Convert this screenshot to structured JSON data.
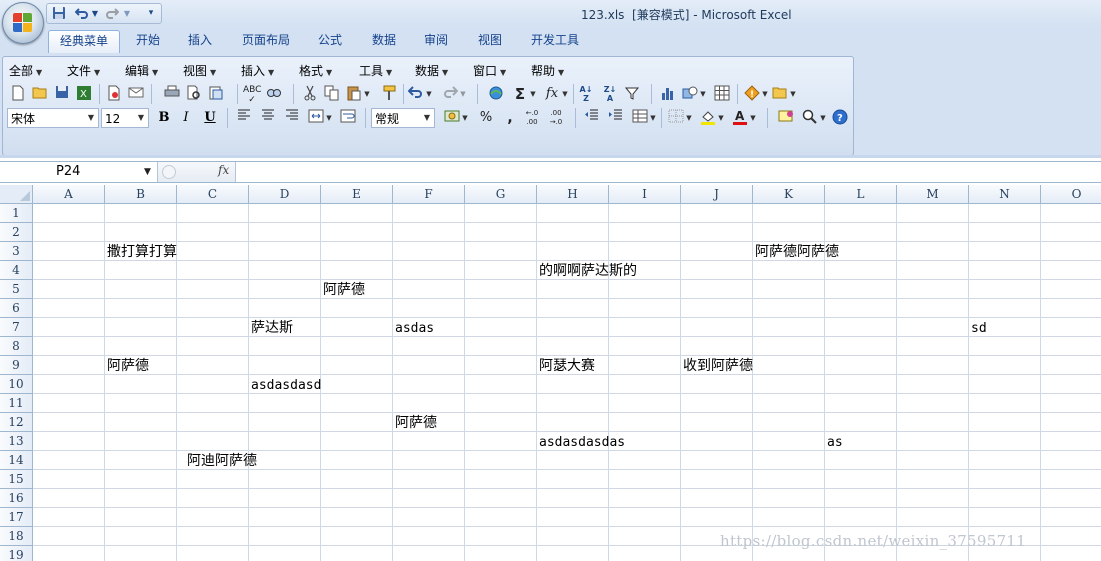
{
  "window": {
    "title": "123.xls  [兼容模式] - Microsoft Excel"
  },
  "quick_access": {
    "save_icon": "save-icon",
    "undo_icon": "undo-icon",
    "redo_icon": "redo-icon",
    "customize_icon": "customize-icon"
  },
  "ribbon_tabs": [
    "经典菜单",
    "开始",
    "插入",
    "页面布局",
    "公式",
    "数据",
    "审阅",
    "视图",
    "开发工具"
  ],
  "active_tab": "经典菜单",
  "classic_menu": [
    "全部",
    "文件",
    "编辑",
    "视图",
    "插入",
    "格式",
    "工具",
    "数据",
    "窗口",
    "帮助"
  ],
  "font": {
    "name": "宋体",
    "size": "12",
    "number_format": "常规",
    "bold_label": "B",
    "italic_label": "I",
    "underline_label": "U",
    "percent_label": "%",
    "comma_label": ","
  },
  "formula_bar": {
    "name_box": "P24",
    "fx": "fx",
    "formula": ""
  },
  "columns": [
    "A",
    "B",
    "C",
    "D",
    "E",
    "F",
    "G",
    "H",
    "I",
    "J",
    "K",
    "L",
    "M",
    "N",
    "O"
  ],
  "rows": [
    "1",
    "2",
    "3",
    "4",
    "5",
    "6",
    "7",
    "8",
    "9",
    "10",
    "11",
    "12",
    "13",
    "14",
    "15",
    "16",
    "17",
    "18",
    "19"
  ],
  "cells": [
    {
      "ref": "B3",
      "text": "撒打算打算"
    },
    {
      "ref": "K3",
      "text": "阿萨德阿萨德"
    },
    {
      "ref": "H4",
      "text": "的啊啊萨达斯的"
    },
    {
      "ref": "E5",
      "text": "阿萨德"
    },
    {
      "ref": "D7",
      "text": "萨达斯"
    },
    {
      "ref": "F7",
      "text": "asdas"
    },
    {
      "ref": "N7",
      "text": "sd"
    },
    {
      "ref": "B9",
      "text": "阿萨德"
    },
    {
      "ref": "H9",
      "text": "阿瑟大赛"
    },
    {
      "ref": "J9",
      "text": "收到阿萨德"
    },
    {
      "ref": "D10",
      "text": "asdasdasd"
    },
    {
      "ref": "F12",
      "text": "阿萨德"
    },
    {
      "ref": "H13",
      "text": "asdasdasdas"
    },
    {
      "ref": "L13",
      "text": "as"
    },
    {
      "ref": "C14",
      "text": "阿迪阿萨德"
    }
  ],
  "watermark": "https://blog.csdn.net/weixin_37595711"
}
